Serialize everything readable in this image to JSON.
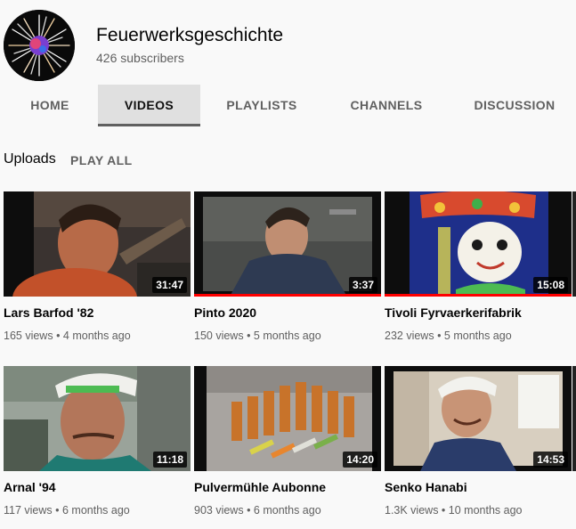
{
  "channel": {
    "title": "Feuerwerksgeschichte",
    "subscribers": "426 subscribers",
    "avatar_icon": "fireworks-burst-icon"
  },
  "tabs": [
    {
      "label": "HOME",
      "active": false
    },
    {
      "label": "VIDEOS",
      "active": true
    },
    {
      "label": "PLAYLISTS",
      "active": false
    },
    {
      "label": "CHANNELS",
      "active": false
    },
    {
      "label": "DISCUSSION",
      "active": false
    }
  ],
  "shelf": {
    "title": "Uploads",
    "play_all": "PLAY ALL"
  },
  "videos": [
    {
      "title": "Lars Barfod '82",
      "duration": "31:47",
      "views": "165 views",
      "age": "4 months ago",
      "watched": 0
    },
    {
      "title": "Pinto 2020",
      "duration": "3:37",
      "views": "150 views",
      "age": "5 months ago",
      "watched": 1
    },
    {
      "title": "Tivoli Fyrvaerkerifabrik",
      "duration": "15:08",
      "views": "232 views",
      "age": "5 months ago",
      "watched": 1
    },
    {
      "title": "Arnal '94",
      "duration": "11:18",
      "views": "117 views",
      "age": "6 months ago",
      "watched": 0
    },
    {
      "title": "Pulvermühle Aubonne",
      "duration": "14:20",
      "views": "903 views",
      "age": "6 months ago",
      "watched": 0
    },
    {
      "title": "Senko Hanabi",
      "duration": "14:53",
      "views": "1.3K views",
      "age": "10 months ago",
      "watched": 0
    }
  ],
  "colors": {
    "background": "#f9f9f9",
    "active_tab": "#e0e0e0",
    "progress": "#ff0000",
    "text_primary": "#030303",
    "text_secondary": "#606060"
  }
}
